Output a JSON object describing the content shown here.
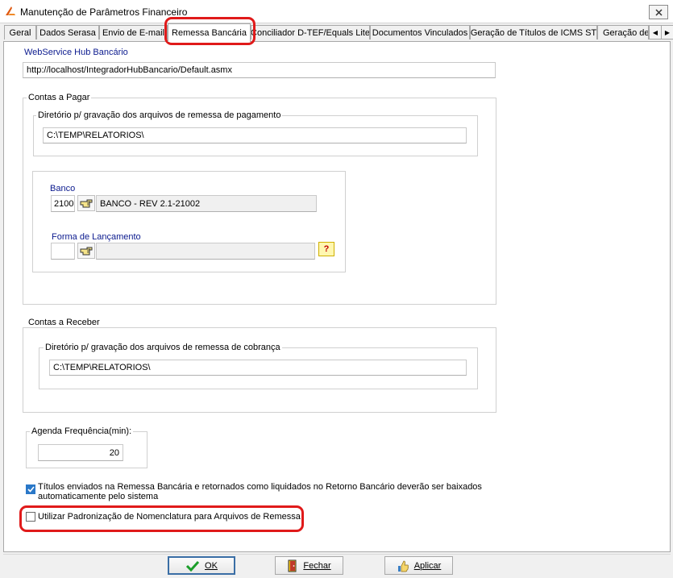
{
  "window": {
    "title": "Manutenção de Parâmetros Financeiro"
  },
  "tabs": [
    {
      "label": "Geral",
      "active": false
    },
    {
      "label": "Dados Serasa",
      "active": false
    },
    {
      "label": "Envio de E-mail",
      "active": false
    },
    {
      "label": "Remessa Bancária",
      "active": true
    },
    {
      "label": "Conciliador D-TEF/Equals Lite",
      "active": false
    },
    {
      "label": "Documentos Vinculados",
      "active": false
    },
    {
      "label": "Geração de Títulos de ICMS ST",
      "active": false
    },
    {
      "label": "Geração de",
      "active": false
    }
  ],
  "webservice": {
    "label": "WebService Hub Bancário",
    "value": "http://localhost/IntegradorHubBancario/Default.asmx"
  },
  "contas_pagar": {
    "title": "Contas a Pagar",
    "diretorio_label": "Diretório p/ gravação dos arquivos de remessa de pagamento",
    "diretorio_value": "C:\\TEMP\\RELATORIOS\\",
    "banco_label": "Banco",
    "banco_code": "2100",
    "banco_name": "BANCO - REV 2.1-21002",
    "forma_label": "Forma de Lançamento",
    "forma_code": "",
    "forma_name": ""
  },
  "contas_receber": {
    "title": "Contas a Receber",
    "diretorio_label": "Diretório p/ gravação dos arquivos de remessa de cobrança",
    "diretorio_value": "C:\\TEMP\\RELATORIOS\\"
  },
  "agenda": {
    "label": "Agenda Frequência(min):",
    "value": "20"
  },
  "options": {
    "baixa_auto_line1": "Títulos enviados na Remessa Bancária e retornados como liquidados no Retorno Bancário deverão ser baixados",
    "baixa_auto_line2": "automaticamente pelo sistema",
    "baixa_auto_checked": true,
    "padronizacao": "Utilizar Padronização de Nomenclatura para Arquivos de Remessa",
    "padronizacao_checked": false
  },
  "buttons": {
    "ok": "OK",
    "fechar": "Fechar",
    "aplicar": "Aplicar"
  },
  "colors": {
    "accent": "#2a78c8",
    "label_blue": "#0b1a8e",
    "annotation_red": "#e01a1a"
  }
}
